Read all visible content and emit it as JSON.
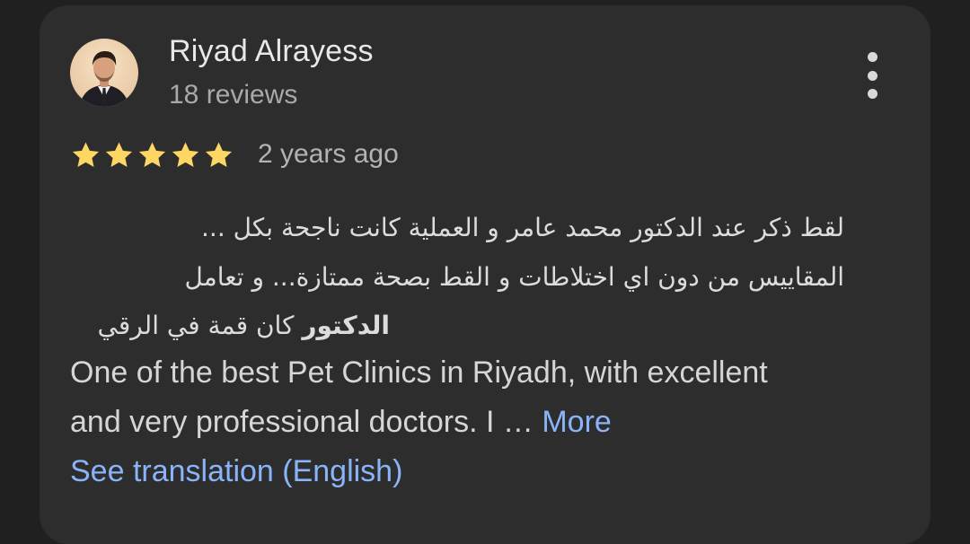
{
  "review": {
    "author": {
      "name": "Riyad Alrayess",
      "reviews_count": "18 reviews",
      "avatar_icon": "user-photo"
    },
    "rating": {
      "stars": 5,
      "max": 5,
      "star_color": "#fdd663"
    },
    "date": "2 years ago",
    "text_arabic": {
      "line1": "لقط ذكر عند الدكتور محمد عامر و العملية كانت ناجحة بكل ...",
      "line2": "المقاييس من دون اي اختلاطات و القط بصحة ممتازة... و تعامل",
      "line3_bold": "الدكتور",
      "line3_rest": " كان قمة في الرقي"
    },
    "text_english": {
      "line1": "One of the best Pet Clinics in Riyadh, with excellent",
      "line2": "and very professional doctors. I … ",
      "more_label": "More"
    },
    "see_translation_label": "See translation (English)",
    "menu_icon": "more-vert-icon"
  },
  "colors": {
    "background": "#202020",
    "card": "#2d2d2e",
    "link": "#8ab4f8",
    "star": "#fdd663"
  }
}
